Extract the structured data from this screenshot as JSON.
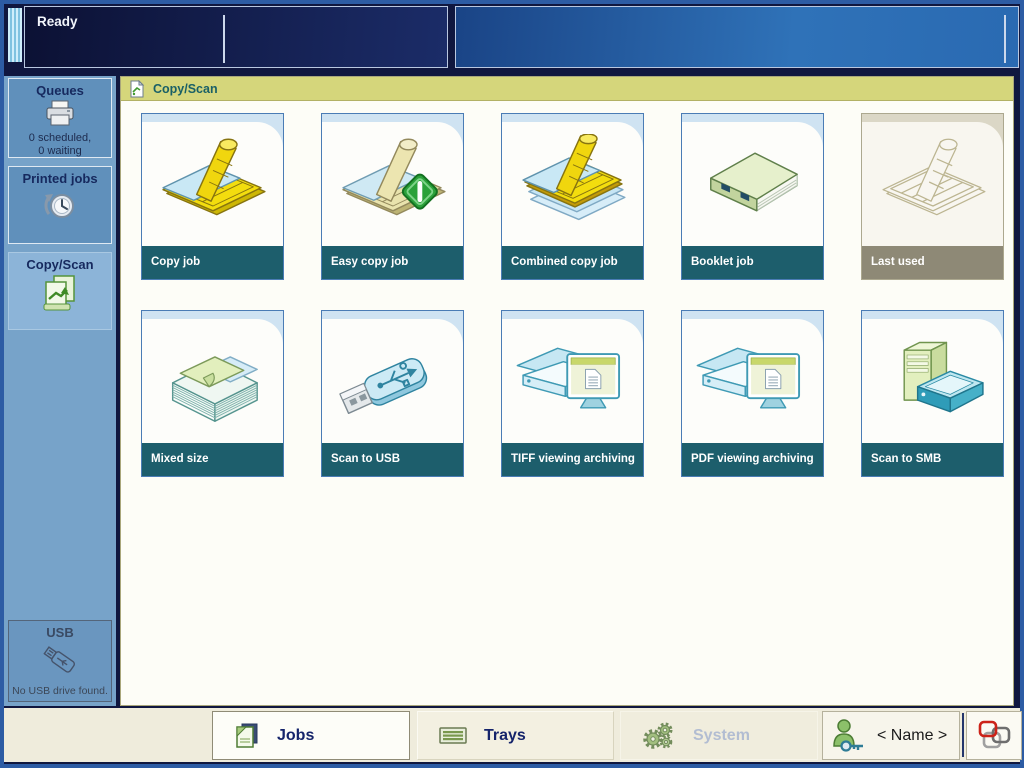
{
  "window": {
    "status": "Ready"
  },
  "sidebar": {
    "queues_title": "Queues",
    "queues_line1": "0 scheduled,",
    "queues_line2": "0 waiting",
    "printed_jobs_title": "Printed jobs",
    "copy_scan_title": "Copy/Scan",
    "usb_title": "USB",
    "usb_message": "No USB drive found."
  },
  "content": {
    "header_title": "Copy/Scan",
    "tiles": [
      {
        "label": "Copy job",
        "icon": "copy-job-icon",
        "state": "enabled"
      },
      {
        "label": "Easy copy job",
        "icon": "easy-copy-job-icon",
        "state": "enabled"
      },
      {
        "label": "Combined copy job",
        "icon": "combined-copy-job-icon",
        "state": "enabled"
      },
      {
        "label": "Booklet job",
        "icon": "booklet-job-icon",
        "state": "enabled"
      },
      {
        "label": "Last used",
        "icon": "last-used-icon",
        "state": "disabled"
      },
      {
        "label": "Mixed size",
        "icon": "mixed-size-icon",
        "state": "enabled"
      },
      {
        "label": "Scan to USB",
        "icon": "scan-to-usb-icon",
        "state": "enabled"
      },
      {
        "label": "TIFF viewing archiving",
        "icon": "tiff-viewing-icon",
        "state": "enabled"
      },
      {
        "label": "PDF viewing archiving",
        "icon": "pdf-viewing-icon",
        "state": "enabled"
      },
      {
        "label": "Scan to SMB",
        "icon": "scan-to-smb-icon",
        "state": "enabled"
      }
    ]
  },
  "bottom_bar": {
    "jobs_label": "Jobs",
    "trays_label": "Trays",
    "system_label": "System",
    "name_label": "< Name >"
  },
  "colors": {
    "frame_blue": "#2d5ca4",
    "backdrop_navy": "#10173f",
    "sidebar_bg": "#77a3c9",
    "sidebar_selected": "#8cb4d8",
    "content_header_bg": "#d5d67b",
    "tile_border": "#4a7cb5",
    "tile_footer_teal": "#1d5e6c",
    "tile_disabled_footer": "#8e8976",
    "bottom_bar_bg": "#efecdc",
    "active_tab_text": "#15246b"
  }
}
